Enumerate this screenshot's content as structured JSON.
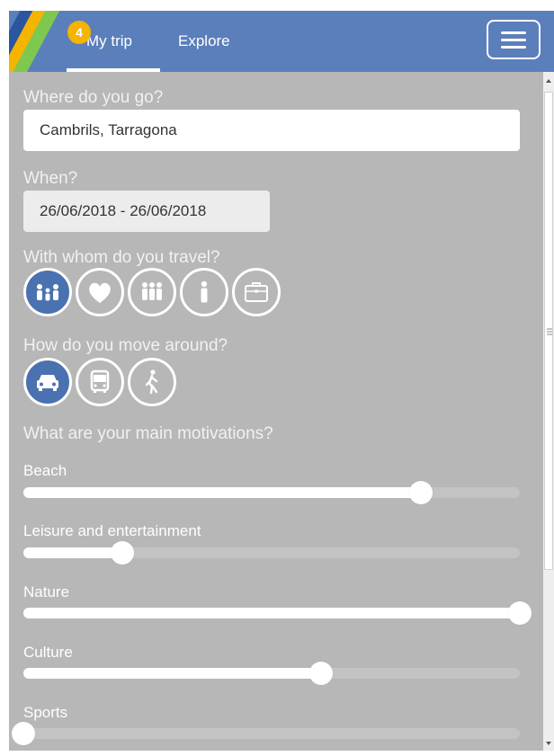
{
  "header": {
    "badge_count": "4",
    "tabs": [
      {
        "label": "My trip",
        "active": true
      },
      {
        "label": "Explore",
        "active": false
      }
    ],
    "colors": {
      "background": "#5b7fbb",
      "badge": "#f4b400"
    }
  },
  "form": {
    "destination": {
      "question": "Where do you go?",
      "value": "Cambrils, Tarragona"
    },
    "dates": {
      "question": "When?",
      "value": "26/06/2018 - 26/06/2018"
    },
    "companions": {
      "question": "With whom do you travel?",
      "options": [
        {
          "icon": "family-icon",
          "selected": true
        },
        {
          "icon": "heart-icon",
          "selected": false
        },
        {
          "icon": "group-icon",
          "selected": false
        },
        {
          "icon": "single-person-icon",
          "selected": false
        },
        {
          "icon": "briefcase-icon",
          "selected": false
        }
      ]
    },
    "transport": {
      "question": "How do you move around?",
      "options": [
        {
          "icon": "car-icon",
          "selected": true
        },
        {
          "icon": "bus-icon",
          "selected": false
        },
        {
          "icon": "walking-icon",
          "selected": false
        }
      ]
    },
    "motivations": {
      "question": "What are your main motivations?",
      "sliders": [
        {
          "label": "Beach",
          "value": 0.8
        },
        {
          "label": "Leisure and entertainment",
          "value": 0.2
        },
        {
          "label": "Nature",
          "value": 1.0
        },
        {
          "label": "Culture",
          "value": 0.6
        },
        {
          "label": "Sports",
          "value": 0.0
        }
      ]
    }
  },
  "colors": {
    "content_bg": "#b7b7b7",
    "selected_icon": "#4a72b0"
  }
}
